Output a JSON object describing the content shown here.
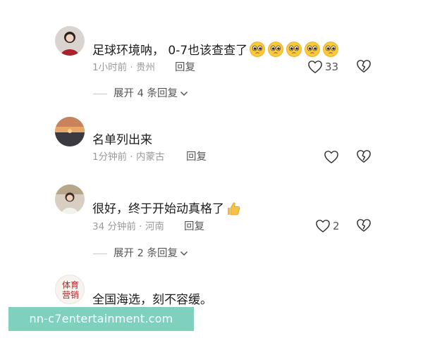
{
  "comments": [
    {
      "text": "足球环境呐， 0-7也该查查了",
      "emoji": "pleading-face",
      "emoji_count": 5,
      "meta": "1小时前 · 贵州",
      "reply": "回复",
      "likes": "33",
      "expand": "展开 4 条回复"
    },
    {
      "text": "名单列出来",
      "meta": "1分钟前 · 内蒙古",
      "reply": "回复",
      "likes": ""
    },
    {
      "text": "很好，终于开始动真格了",
      "emoji": "thumbs-up",
      "meta": "34 分钟前 · 河南",
      "reply": "回复",
      "likes": "2",
      "expand": "展开 2 条回复"
    },
    {
      "text": "全国海选，刻不容缓。",
      "avatar_text": "体育\n营销"
    }
  ],
  "watermark": "nn-c7entertainment.com",
  "colors": {
    "text": "#1c1c1c",
    "meta": "#9a9a9a",
    "watermark_bg": "#7fd1bd",
    "avatar_badge": "#b3262d"
  }
}
